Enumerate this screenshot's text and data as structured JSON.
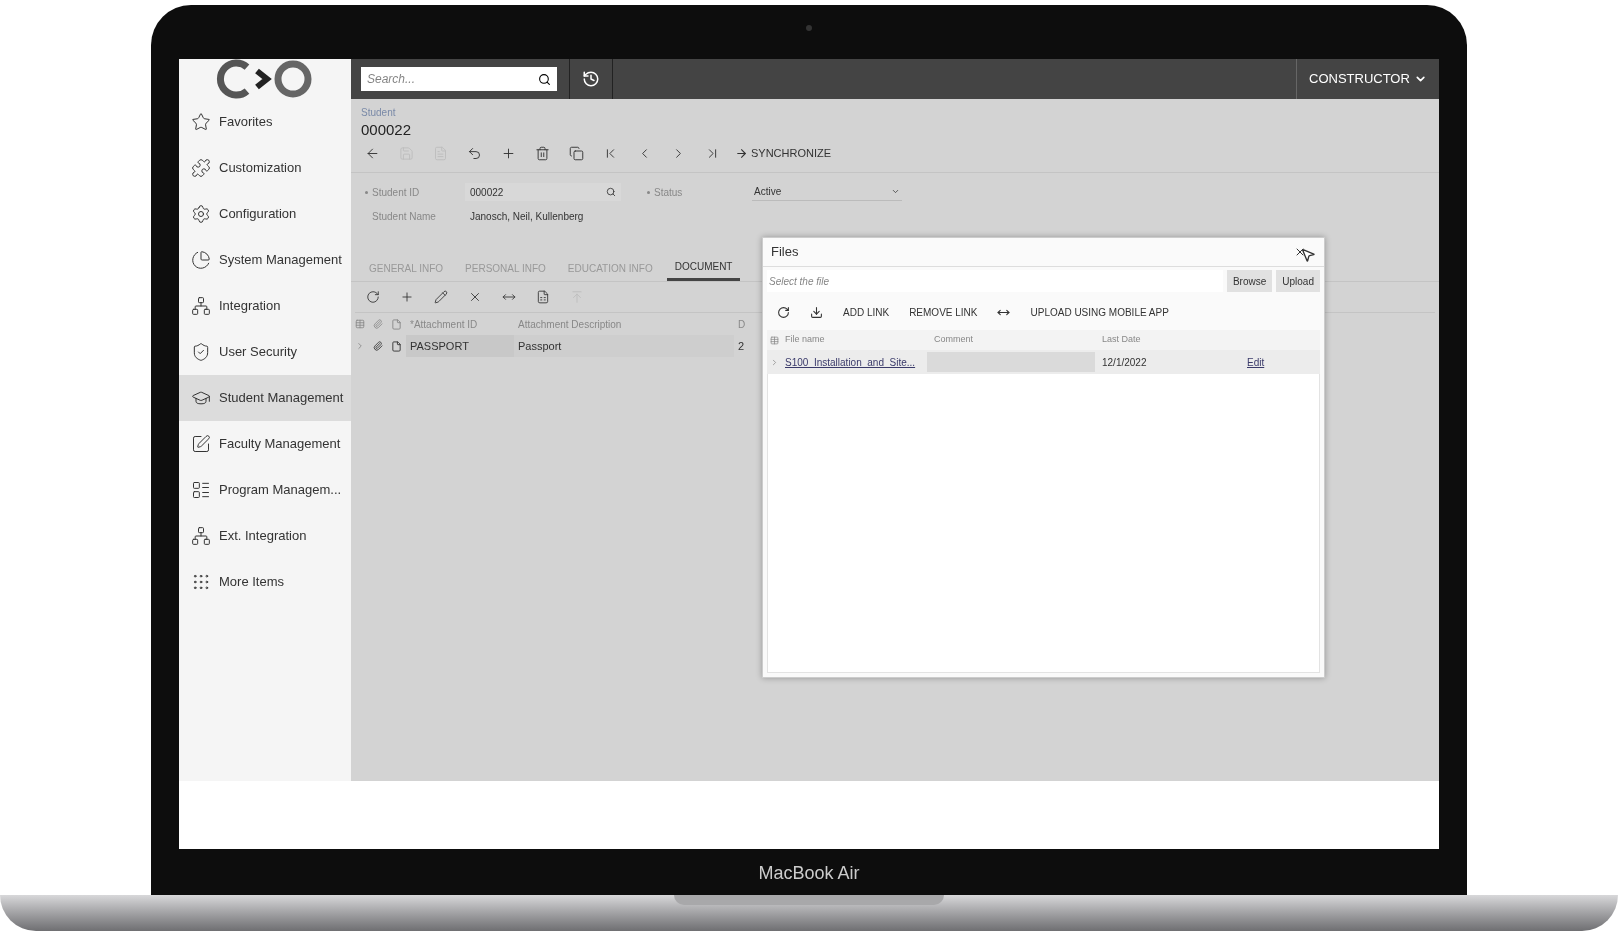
{
  "laptop": {
    "label": "MacBook Air"
  },
  "sidebar": {
    "items": [
      {
        "label": "Favorites",
        "selected": false
      },
      {
        "label": "Customization",
        "selected": false
      },
      {
        "label": "Configuration",
        "selected": false
      },
      {
        "label": "System Management",
        "selected": false
      },
      {
        "label": "Integration",
        "selected": false
      },
      {
        "label": "User Security",
        "selected": false
      },
      {
        "label": "Student Management",
        "selected": true
      },
      {
        "label": "Faculty Management",
        "selected": false
      },
      {
        "label": "Program Managem...",
        "selected": false
      },
      {
        "label": "Ext. Integration",
        "selected": false
      },
      {
        "label": "More Items",
        "selected": false
      }
    ]
  },
  "top_bar": {
    "search": {
      "placeholder": "Search..."
    },
    "user_menu": "CONSTRUCTOR"
  },
  "record": {
    "breadcrumb": "Student",
    "title": "000022",
    "toolbar": {
      "buttons": [
        {
          "disabled": false
        },
        {
          "disabled": true
        },
        {
          "disabled": true
        },
        {
          "disabled": false
        },
        {
          "disabled": false
        },
        {
          "disabled": false
        },
        {
          "disabled": false
        },
        {
          "disabled": false
        },
        {
          "disabled": false
        },
        {
          "disabled": false
        },
        {
          "disabled": false
        }
      ],
      "action": "SYNCHRONIZE"
    },
    "fields": [
      {
        "label": "Student ID",
        "required": true,
        "value": "000022",
        "kind": "lookup"
      },
      {
        "label": "Student Name",
        "required": false,
        "value": "Janosch, Neil, Kullenberg",
        "kind": "text"
      },
      {
        "label": "Status",
        "required": true,
        "value": "Active",
        "kind": "select"
      }
    ]
  },
  "tabs": [
    {
      "label": "GENERAL INFO",
      "selected": false
    },
    {
      "label": "PERSONAL INFO",
      "selected": false
    },
    {
      "label": "EDUCATION INFO",
      "selected": false
    },
    {
      "label": "DOCUMENT",
      "selected": true
    }
  ],
  "grid": {
    "toolbar": {
      "buttons": [
        {
          "disabled": false
        },
        {
          "disabled": false
        },
        {
          "disabled": false
        },
        {
          "disabled": false
        },
        {
          "disabled": false
        },
        {
          "disabled": false
        },
        {
          "disabled": true
        }
      ]
    },
    "columns": [
      "*Attachment ID",
      "Attachment Description",
      "D"
    ],
    "rows": [
      {
        "cells": [
          "PASSPORT",
          "Passport",
          "2"
        ]
      }
    ]
  },
  "dialog": {
    "title": "Files",
    "file_field": {
      "placeholder": "Select the file"
    },
    "buttons": [
      "Browse",
      "Upload"
    ],
    "toolbar": [
      {
        "kind": "icon"
      },
      {
        "kind": "icon"
      },
      {
        "kind": "text",
        "label": "ADD LINK"
      },
      {
        "kind": "text",
        "label": "REMOVE LINK"
      },
      {
        "kind": "icon"
      },
      {
        "kind": "text",
        "label": "UPLOAD USING MOBILE APP"
      }
    ],
    "columns": [
      "File name",
      "Comment",
      "Last Date"
    ],
    "rows": [
      {
        "file_name": "S100_Installation_and_Site...",
        "date": "12/1/2022",
        "action": "Edit"
      }
    ]
  }
}
